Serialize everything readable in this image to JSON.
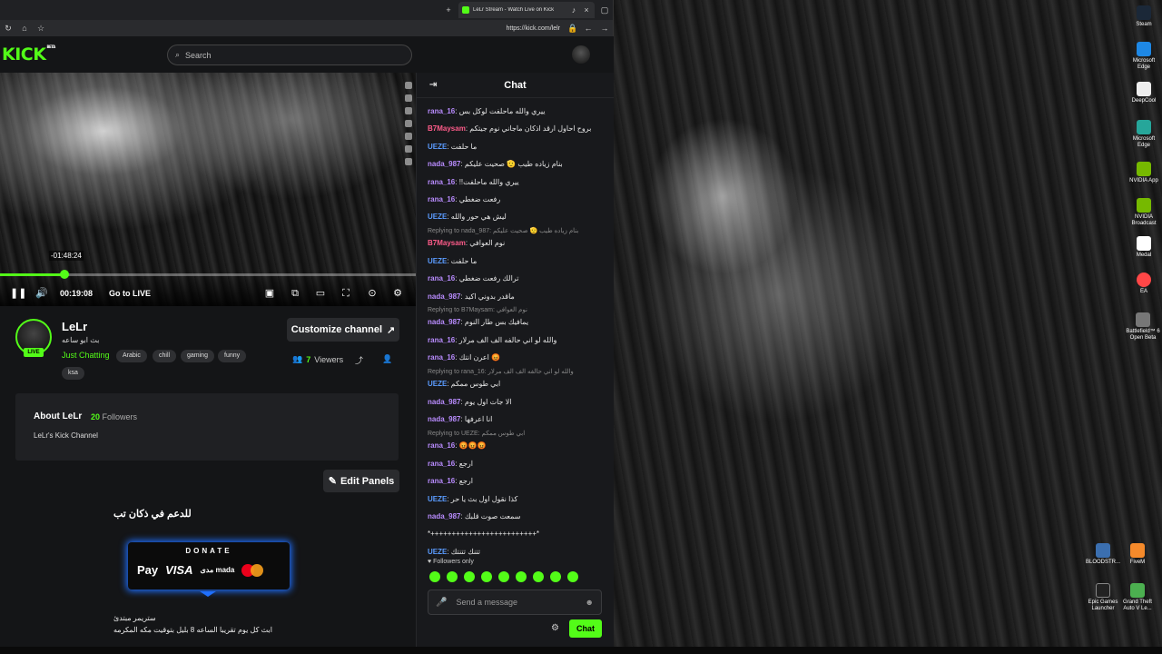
{
  "browser": {
    "tab_title": "LeLr Stream - Watch Live on Kick",
    "url": "https://kick.com/lelr"
  },
  "header": {
    "logo": "KICK",
    "logo_badge": "BETA",
    "search_placeholder": "Search"
  },
  "player": {
    "hover_time": "-01:48:24",
    "elapsed": "00:19:08",
    "go_live": "Go to LIVE",
    "progress_fraction": 0.155
  },
  "channel": {
    "name": "LeLr",
    "stream_title": "بث ابو ساعه",
    "category": "Just Chatting",
    "tags": [
      "Arabic",
      "chill",
      "gaming",
      "funny",
      "ksa"
    ],
    "live_label": "LIVE",
    "customize_label": "Customize channel",
    "viewers_count": "7",
    "viewers_label": "Viewers"
  },
  "about": {
    "title": "About LeLr",
    "followers_count": "20",
    "followers_label": "Followers",
    "description": "LeLr's Kick Channel"
  },
  "panels": {
    "edit_label": "Edit Panels",
    "heading": "للدعم في ذكان تب",
    "donate_label": "DONATE",
    "pay_methods": [
      "Pay",
      "VISA",
      "مدى mada"
    ],
    "footer_line1": "ستريمر مبتدئ",
    "footer_line2": "ابث كل يوم تقريبا الساعه 8 بليل بتوقيت مكه المكرمه"
  },
  "chat": {
    "title": "Chat",
    "messages": [
      {
        "user": "rana_16",
        "color": "#b98cff",
        "text": "ييري والله ماحلفت لوكل بس"
      },
      {
        "user": "B7Maysam",
        "color": "#ff5c8a",
        "text": "بروح احاول ارقد اذكان ماجاني نوم جيتكم"
      },
      {
        "user": "UEZE",
        "color": "#5b9cff",
        "text": "ما حلفت"
      },
      {
        "user": "nada_987",
        "color": "#b98cff",
        "text": "بنام زياده طيب 🫡 صحيت عليكم"
      },
      {
        "user": "rana_16",
        "color": "#b98cff",
        "text": "!!ييري والله ماحلفت"
      },
      {
        "user": "rana_16",
        "color": "#b98cff",
        "text": "رفعت ضغطي"
      },
      {
        "user": "UEZE",
        "color": "#5b9cff",
        "text": "ليش هي حور والله"
      },
      {
        "user": "B7Maysam",
        "color": "#ff5c8a",
        "text": "نوم العوافي",
        "reply": "Replying to nada_987: بنام زياده طيب 🫡 صحيت عليكم"
      },
      {
        "user": "UEZE",
        "color": "#5b9cff",
        "text": "ما حلفت"
      },
      {
        "user": "rana_16",
        "color": "#b98cff",
        "text": "ترالك رفعت ضغطي"
      },
      {
        "user": "nada_987",
        "color": "#b98cff",
        "text": "ماقدر بدوني اكيد"
      },
      {
        "user": "nada_987",
        "color": "#b98cff",
        "text": "يمافيك بس طار النوم",
        "reply": "Replying to B7Maysam: نوم العوافي"
      },
      {
        "user": "rana_16",
        "color": "#b98cff",
        "text": "والله لو اني حالفه الف الف مرلار"
      },
      {
        "user": "rana_16",
        "color": "#b98cff",
        "text": "اعرن انتك 😡"
      },
      {
        "user": "UEZE",
        "color": "#5b9cff",
        "text": "ابي طوس ممكم",
        "reply": "Replying to rana_16: والله لو اني حالفه الف الف مرلار"
      },
      {
        "user": "nada_987",
        "color": "#b98cff",
        "text": "الا جات اول يوم"
      },
      {
        "user": "nada_987",
        "color": "#b98cff",
        "text": "انا اعرفها"
      },
      {
        "user": "rana_16",
        "color": "#b98cff",
        "text": "😡😡😡",
        "reply": "Replying to UEZE: ابي طوس ممكم"
      },
      {
        "user": "rana_16",
        "color": "#b98cff",
        "text": "ارجع"
      },
      {
        "user": "rana_16",
        "color": "#b98cff",
        "text": "ارجع"
      },
      {
        "user": "UEZE",
        "color": "#5b9cff",
        "text": "كذا نقول اول بث يا حر"
      },
      {
        "user": "nada_987",
        "color": "#b98cff",
        "text": "سمعت صوت قلبك"
      },
      {
        "user": "",
        "color": "#e6e6e6",
        "text": "*+++++++++++++++++++++++++*"
      },
      {
        "user": "UEZE",
        "color": "#5b9cff",
        "text": "تتنك تتنتك"
      }
    ],
    "followers_only": "Followers only",
    "input_placeholder": "Send a message",
    "send_label": "Chat"
  },
  "desktop_icons": [
    "Steam",
    "Microsoft Edge",
    "DeepCool",
    "Microsoft Edge",
    "NVIDIA App",
    "NVIDIA Broadcast",
    "Medal",
    "EA",
    "Battlefield™ 6 Open Beta",
    "BLOODSTR...",
    "FiveM",
    "Epic Games Launcher",
    "Grand Theft Auto V Le..."
  ],
  "colors": {
    "accent": "#53fc18",
    "background": "#141517",
    "chat_bg": "#18191c"
  }
}
